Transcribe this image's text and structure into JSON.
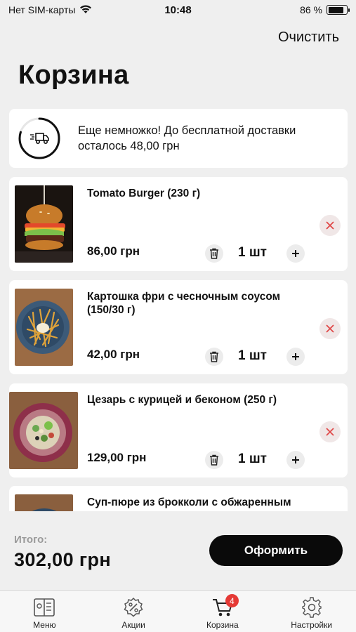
{
  "status_bar": {
    "carrier": "Нет SIM-карты",
    "time": "10:48",
    "battery_percent": "86 %",
    "battery_level": 0.86
  },
  "header": {
    "clear_label": "Очистить",
    "title": "Корзина"
  },
  "delivery": {
    "message": "Еще немножко! До бесплатной доставки осталось 48,00 грн",
    "progress": 0.8
  },
  "items": [
    {
      "name": "Tomato Burger (230 г)",
      "price": "86,00 грн",
      "qty": "1 шт"
    },
    {
      "name": "Картошка фри с чесночным соусом (150/30 г)",
      "price": "42,00 грн",
      "qty": "1 шт"
    },
    {
      "name": "Цезарь с курицей и беконом (250 г)",
      "price": "129,00 грн",
      "qty": "1 шт"
    },
    {
      "name": "Суп-пюре из брокколи с обжаренным",
      "price": "",
      "qty": ""
    }
  ],
  "footer": {
    "total_label": "Итого:",
    "total_value": "302,00 грн",
    "checkout_label": "Оформить"
  },
  "tabs": [
    {
      "label": "Меню",
      "icon": "menu-book-icon"
    },
    {
      "label": "Акции",
      "icon": "percent-badge-icon"
    },
    {
      "label": "Корзина",
      "icon": "cart-icon",
      "badge": "4"
    },
    {
      "label": "Настройки",
      "icon": "gear-icon"
    }
  ],
  "colors": {
    "accent": "#0a0a0a",
    "badge": "#e53935",
    "remove": "#e04848"
  }
}
